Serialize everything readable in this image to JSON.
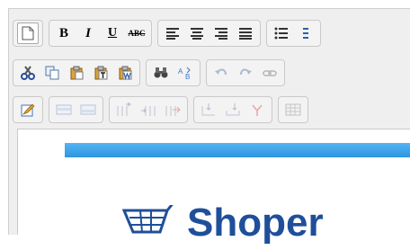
{
  "toolbar": {
    "format": {
      "bold_label": "B",
      "italic_label": "I",
      "underline_label": "U",
      "strikethrough_label": "ABC"
    }
  },
  "content": {
    "logo_text": "Shoper"
  },
  "colors": {
    "banner": "#3aa3ea",
    "logo": "#1f4f9a",
    "toolbar_bg": "#efefef"
  }
}
